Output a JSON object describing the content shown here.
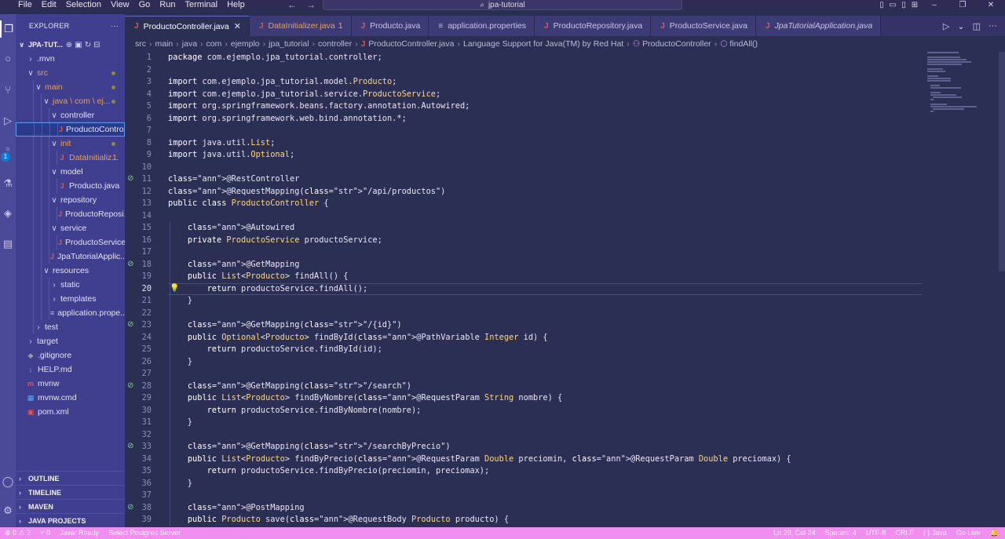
{
  "titlebar": {
    "menu": [
      "File",
      "Edit",
      "Selection",
      "View",
      "Go",
      "Run",
      "Terminal",
      "Help"
    ],
    "search_text": "jpa-tutorial"
  },
  "activity": {
    "icons": [
      "explorer-icon",
      "search-icon",
      "source-control-icon",
      "run-debug-icon",
      "extensions-icon",
      "testing-icon",
      "docker-icon",
      "database-icon",
      "accounts-icon",
      "settings-gear-icon"
    ],
    "extensions_badge": "1"
  },
  "sidebar": {
    "title": "EXPLORER",
    "more": "···",
    "project": "JPA-TUT...",
    "tree": [
      {
        "label": ".mvn",
        "indent": 1,
        "type": "folder",
        "open": false
      },
      {
        "label": "src",
        "indent": 1,
        "type": "folder",
        "open": true,
        "status": "orange",
        "dot": true
      },
      {
        "label": "main",
        "indent": 2,
        "type": "folder",
        "open": true,
        "status": "orange",
        "dot": true
      },
      {
        "label": "java \\ com \\ ej...",
        "indent": 3,
        "type": "folder",
        "open": true,
        "status": "orange",
        "dot": true
      },
      {
        "label": "controller",
        "indent": 4,
        "type": "folder",
        "open": true
      },
      {
        "label": "ProductoContro...",
        "indent": 5,
        "type": "java",
        "selected": true
      },
      {
        "label": "init",
        "indent": 4,
        "type": "folder",
        "open": true,
        "status": "orange",
        "dot": true
      },
      {
        "label": "DataInitializ...",
        "indent": 5,
        "type": "java",
        "status": "orange",
        "err": "1"
      },
      {
        "label": "model",
        "indent": 4,
        "type": "folder",
        "open": true
      },
      {
        "label": "Producto.java",
        "indent": 5,
        "type": "java"
      },
      {
        "label": "repository",
        "indent": 4,
        "type": "folder",
        "open": true
      },
      {
        "label": "ProductoReposi...",
        "indent": 5,
        "type": "java"
      },
      {
        "label": "service",
        "indent": 4,
        "type": "folder",
        "open": true
      },
      {
        "label": "ProductoService....",
        "indent": 5,
        "type": "java"
      },
      {
        "label": "JpaTutorialApplic...",
        "indent": 4,
        "type": "java-nochev"
      },
      {
        "label": "resources",
        "indent": 3,
        "type": "folder",
        "open": true
      },
      {
        "label": "static",
        "indent": 4,
        "type": "folder",
        "open": false
      },
      {
        "label": "templates",
        "indent": 4,
        "type": "folder",
        "open": false
      },
      {
        "label": "application.prope...",
        "indent": 4,
        "type": "props"
      },
      {
        "label": "test",
        "indent": 2,
        "type": "folder",
        "open": false
      },
      {
        "label": "target",
        "indent": 1,
        "type": "folder",
        "open": false
      },
      {
        "label": ".gitignore",
        "indent": 1,
        "type": "git"
      },
      {
        "label": "HELP.md",
        "indent": 1,
        "type": "md"
      },
      {
        "label": "mvnw",
        "indent": 1,
        "type": "mvn"
      },
      {
        "label": "mvnw.cmd",
        "indent": 1,
        "type": "cmd"
      },
      {
        "label": "pom.xml",
        "indent": 1,
        "type": "xml"
      }
    ],
    "bottom_sections": [
      "OUTLINE",
      "TIMELINE",
      "MAVEN",
      "JAVA PROJECTS"
    ]
  },
  "tabs": [
    {
      "label": "ProductoController.java",
      "active": true,
      "icon": "J"
    },
    {
      "label": "DataInitializer.java",
      "modified": "1",
      "icon": "J"
    },
    {
      "label": "Producto.java",
      "icon": "J"
    },
    {
      "label": "application.properties",
      "icon": "≡"
    },
    {
      "label": "ProductoRepository.java",
      "icon": "J"
    },
    {
      "label": "ProductoService.java",
      "icon": "J"
    },
    {
      "label": "JpaTutorialApplication.java",
      "icon": "J",
      "italic": true
    }
  ],
  "breadcrumb": [
    "src",
    "main",
    "java",
    "com",
    "ejemplo",
    "jpa_tutorial",
    "controller",
    "ProductoController.java",
    "Language Support for Java(TM) by Red Hat",
    "ProductoController",
    "findAll()"
  ],
  "editor": {
    "current_line": 20,
    "lines": [
      {
        "n": 1,
        "t": "package com.ejemplo.jpa_tutorial.controller;"
      },
      {
        "n": 2,
        "t": ""
      },
      {
        "n": 3,
        "t": "import com.ejemplo.jpa_tutorial.model.Producto;"
      },
      {
        "n": 4,
        "t": "import com.ejemplo.jpa_tutorial.service.ProductoService;"
      },
      {
        "n": 5,
        "t": "import org.springframework.beans.factory.annotation.Autowired;"
      },
      {
        "n": 6,
        "t": "import org.springframework.web.bind.annotation.*;"
      },
      {
        "n": 7,
        "t": ""
      },
      {
        "n": 8,
        "t": "import java.util.List;"
      },
      {
        "n": 9,
        "t": "import java.util.Optional;"
      },
      {
        "n": 10,
        "t": ""
      },
      {
        "n": 11,
        "t": "@RestController",
        "gicon": true
      },
      {
        "n": 12,
        "t": "@RequestMapping(\"/api/productos\")"
      },
      {
        "n": 13,
        "t": "public class ProductoController {"
      },
      {
        "n": 14,
        "t": ""
      },
      {
        "n": 15,
        "t": "    @Autowired"
      },
      {
        "n": 16,
        "t": "    private ProductoService productoService;"
      },
      {
        "n": 17,
        "t": ""
      },
      {
        "n": 18,
        "t": "    @GetMapping",
        "gicon": true
      },
      {
        "n": 19,
        "t": "    public List<Producto> findAll() {"
      },
      {
        "n": 20,
        "t": "        return productoService.findAll();",
        "bulb": true
      },
      {
        "n": 21,
        "t": "    }"
      },
      {
        "n": 22,
        "t": ""
      },
      {
        "n": 23,
        "t": "    @GetMapping(\"/{id}\")",
        "gicon": true
      },
      {
        "n": 24,
        "t": "    public Optional<Producto> findById(@PathVariable Integer id) {"
      },
      {
        "n": 25,
        "t": "        return productoService.findById(id);"
      },
      {
        "n": 26,
        "t": "    }"
      },
      {
        "n": 27,
        "t": ""
      },
      {
        "n": 28,
        "t": "    @GetMapping(\"/search\")",
        "gicon": true
      },
      {
        "n": 29,
        "t": "    public List<Producto> findByNombre(@RequestParam String nombre) {"
      },
      {
        "n": 30,
        "t": "        return productoService.findByNombre(nombre);"
      },
      {
        "n": 31,
        "t": "    }"
      },
      {
        "n": 32,
        "t": ""
      },
      {
        "n": 33,
        "t": "    @GetMapping(\"/searchByPrecio\")",
        "gicon": true
      },
      {
        "n": 34,
        "t": "    public List<Producto> findByPrecio(@RequestParam Double preciomin, @RequestParam Double preciomax) {"
      },
      {
        "n": 35,
        "t": "        return productoService.findByPrecio(preciomin, preciomax);"
      },
      {
        "n": 36,
        "t": "    }"
      },
      {
        "n": 37,
        "t": ""
      },
      {
        "n": 38,
        "t": "    @PostMapping",
        "gicon": true
      },
      {
        "n": 39,
        "t": "    public Producto save(@RequestBody Producto producto) {"
      }
    ]
  },
  "statusbar": {
    "left": [
      "⊗ 0 ⚠ 2",
      "⑂ 0",
      "Java: Ready",
      "Select Postgres Server"
    ],
    "right": [
      "Ln 20, Col 24",
      "Spaces: 4",
      "UTF-8",
      "CRLF",
      "{ } Java",
      "Go Live",
      "🔔"
    ]
  },
  "colors": {
    "background": "#2c2f54",
    "sidebar": "#3f3e8f",
    "activitybar": "#4b4a98",
    "statusbar": "#f08ff0",
    "accent_orange": "#e8a14f",
    "java_red": "#e8544e"
  }
}
